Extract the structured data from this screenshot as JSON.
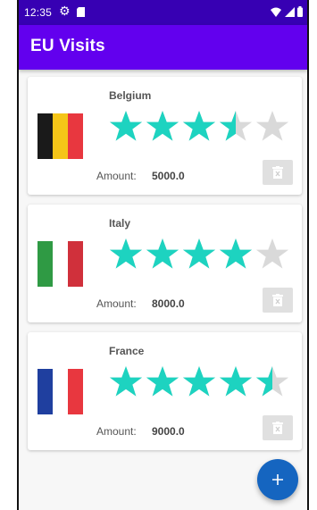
{
  "status_bar": {
    "time": "12:35",
    "icons": [
      "gear-icon",
      "sd-card-icon",
      "wifi-icon",
      "signal-icon",
      "battery-icon"
    ]
  },
  "app_bar": {
    "title": "EU Visits",
    "color": "#6200ee",
    "status_color": "#3700b3"
  },
  "colors": {
    "star_filled": "#1dd3c0",
    "star_empty": "#d9d9d9",
    "fab": "#1565c0"
  },
  "visits": [
    {
      "country": "Belgium",
      "flag_colors": [
        "#1a1a1a",
        "#f5c518",
        "#e8373f"
      ],
      "rating": 3.5,
      "amount_label": "Amount:",
      "amount": "5000.0"
    },
    {
      "country": "Italy",
      "flag_colors": [
        "#2f9a44",
        "#ffffff",
        "#d0303b"
      ],
      "rating": 4,
      "amount_label": "Amount:",
      "amount": "8000.0"
    },
    {
      "country": "France",
      "flag_colors": [
        "#1f3f9f",
        "#ffffff",
        "#e8373f"
      ],
      "rating": 4.5,
      "amount_label": "Amount:",
      "amount": "9000.0"
    }
  ],
  "fab": {
    "icon": "plus-icon",
    "label": "+"
  }
}
